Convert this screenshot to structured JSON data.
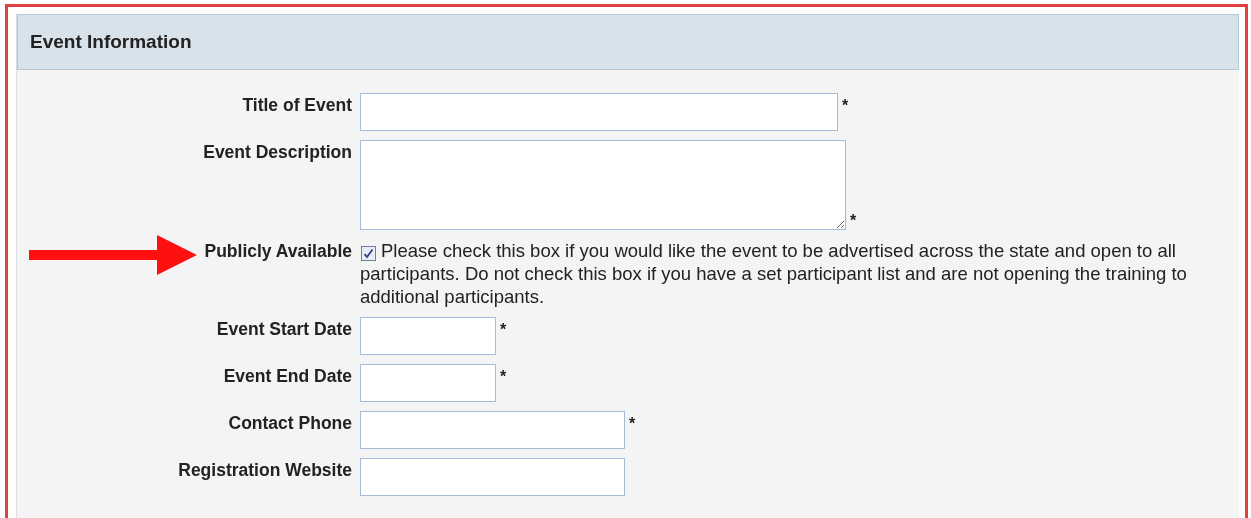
{
  "section": {
    "title": "Event Information"
  },
  "fields": [
    {
      "label": "Title of Event",
      "kind": "text",
      "required": "*"
    },
    {
      "label": "Event Description",
      "kind": "textarea",
      "required": "*"
    },
    {
      "label": "Publicly Available",
      "kind": "checkbox",
      "checked": true,
      "help": "Please check this box if you would like the event to be advertised across the state and open to all participants. Do not check this box if you have a set participant list and are not opening the training to additional participants."
    },
    {
      "label": "Event Start Date",
      "kind": "date",
      "required": "*"
    },
    {
      "label": "Event End Date",
      "kind": "date",
      "required": "*"
    },
    {
      "label": "Contact Phone",
      "kind": "phone",
      "required": "*"
    },
    {
      "label": "Registration Website",
      "kind": "phone"
    }
  ]
}
